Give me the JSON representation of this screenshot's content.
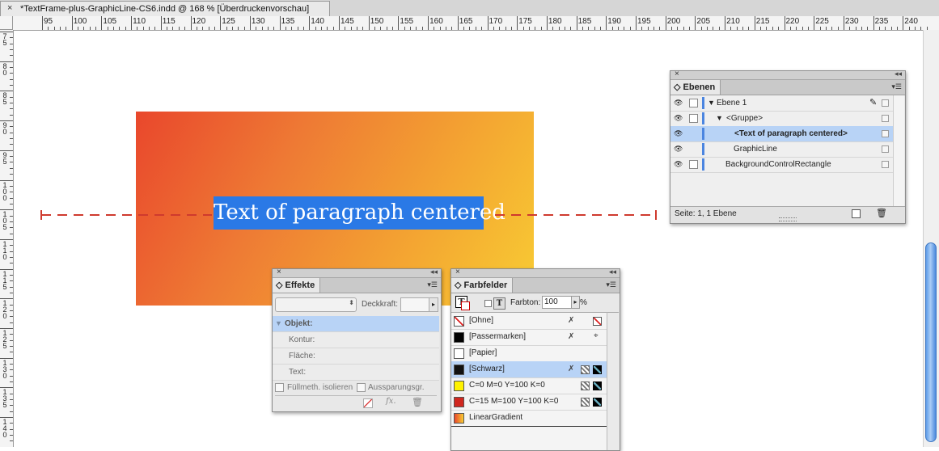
{
  "document_tab": {
    "close": "×",
    "title": "*TextFrame-plus-GraphicLine-CS6.indd @ 168 % [Überdruckenvorschau]"
  },
  "ruler_h_labels": [
    "95",
    "100",
    "105",
    "110",
    "115",
    "120",
    "125",
    "130",
    "135",
    "140",
    "145",
    "150",
    "155",
    "160",
    "165",
    "170",
    "175",
    "180",
    "185",
    "190",
    "195",
    "200",
    "205",
    "210",
    "215",
    "220",
    "225",
    "230",
    "235",
    "240"
  ],
  "ruler_v_labels": [
    "75",
    "80",
    "85",
    "90",
    "95",
    "100",
    "105",
    "110",
    "115",
    "120",
    "125",
    "130",
    "135",
    "140"
  ],
  "canvas": {
    "text_frame": "Text of paragraph centered",
    "gradient_colors": [
      "#e9472c",
      "#ee7a34",
      "#f3a032",
      "#f8cc33"
    ],
    "graphic_line_color": "#cf3a2e"
  },
  "layers_panel": {
    "close": "×",
    "collapse": "◂◂",
    "tab": "Ebenen",
    "menu": "▾☰",
    "rows": [
      {
        "label": "Ebene 1",
        "expander": "▼"
      },
      {
        "label": "<Gruppe>",
        "expander": "▼"
      },
      {
        "label": "<Text of paragraph centered>",
        "expander": ""
      },
      {
        "label": "GraphicLine",
        "expander": ""
      },
      {
        "label": "BackgroundControlRectangle",
        "expander": ""
      }
    ],
    "status": "Seite: 1, 1 Ebene",
    "eye_icon": "👁",
    "pen_icon": "✎"
  },
  "effects_panel": {
    "close": "×",
    "collapse": "◂◂",
    "tab": "Effekte",
    "menu": "▾☰",
    "blend_mode": "",
    "opacity_label": "Deckkraft:",
    "opacity_value": "",
    "rows": [
      "Objekt:",
      "Kontur:",
      "Fläche:",
      "Text:"
    ],
    "isolate_label": "Füllmeth. isolieren",
    "knockout_label": "Aussparungsgr.",
    "fx_label": "fx."
  },
  "swatches_panel": {
    "close": "×",
    "collapse": "◂◂",
    "tab": "Farbfelder",
    "menu": "▾☰",
    "tint_label": "Farbton:",
    "tint_value": "100",
    "percent": "%",
    "rows": [
      {
        "label": "[Ohne]",
        "color": "none"
      },
      {
        "label": "[Passermarken]",
        "color": "#000000"
      },
      {
        "label": "[Papier]",
        "color": "#ffffff"
      },
      {
        "label": "[Schwarz]",
        "color": "#111111"
      },
      {
        "label": "C=0 M=0 Y=100 K=0",
        "color": "#fff200"
      },
      {
        "label": "C=15 M=100 Y=100 K=0",
        "color": "#d0271f"
      },
      {
        "label": "LinearGradient",
        "color": "gradient"
      }
    ]
  }
}
